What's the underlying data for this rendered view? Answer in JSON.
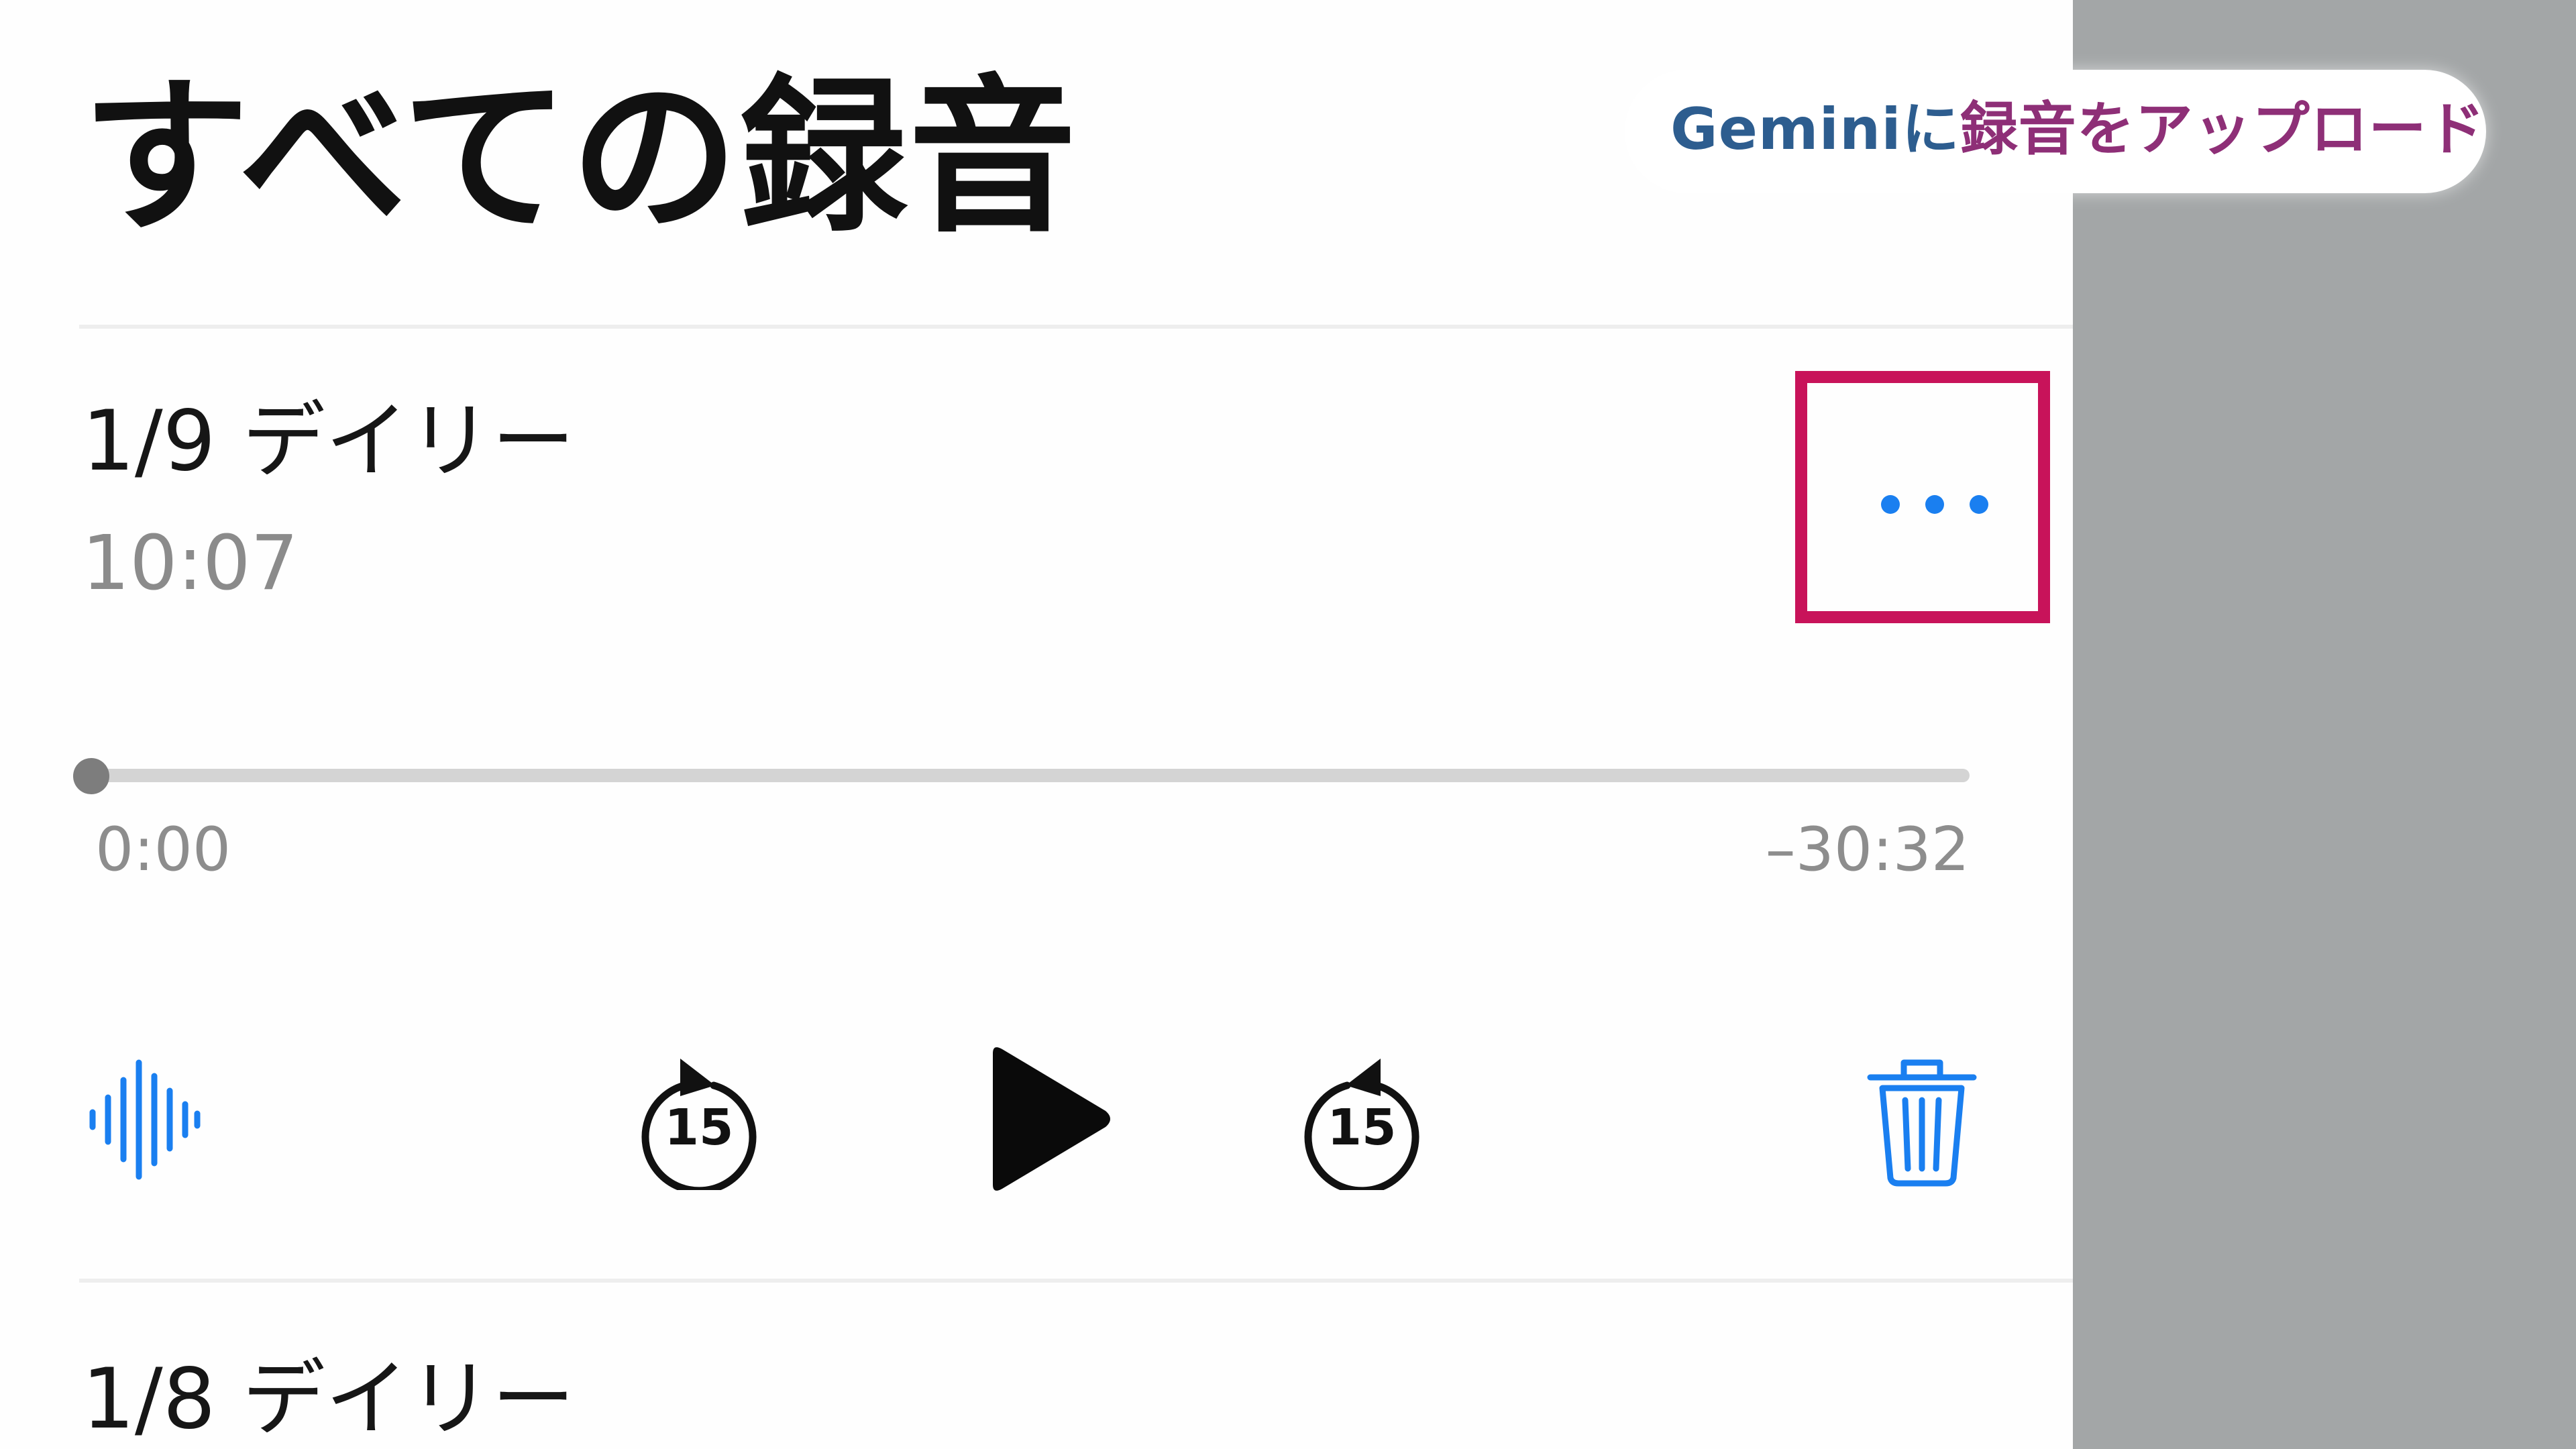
{
  "header": {
    "title": "すべての録音"
  },
  "recordings": [
    {
      "title": "1/9 デイリー",
      "duration": "10:07",
      "elapsed": "0:00",
      "remaining": "–30:32",
      "progress": 0
    },
    {
      "title": "1/8 デイリー"
    }
  ],
  "controls": {
    "more_icon": "ellipsis-icon",
    "waveform_icon": "waveform-icon",
    "skip_back_icon": "rewind-15-icon",
    "skip_back_seconds": "15",
    "play_icon": "play-icon",
    "skip_forward_icon": "forward-15-icon",
    "skip_forward_seconds": "15",
    "delete_icon": "trash-icon"
  },
  "overlay": {
    "upload_prefix": "Geminiに",
    "upload_suffix": "録音をアップロード"
  },
  "colors": {
    "accent_blue": "#1a7ff0",
    "highlight_box": "#c8135a",
    "side_panel": "#a3a6a7"
  }
}
